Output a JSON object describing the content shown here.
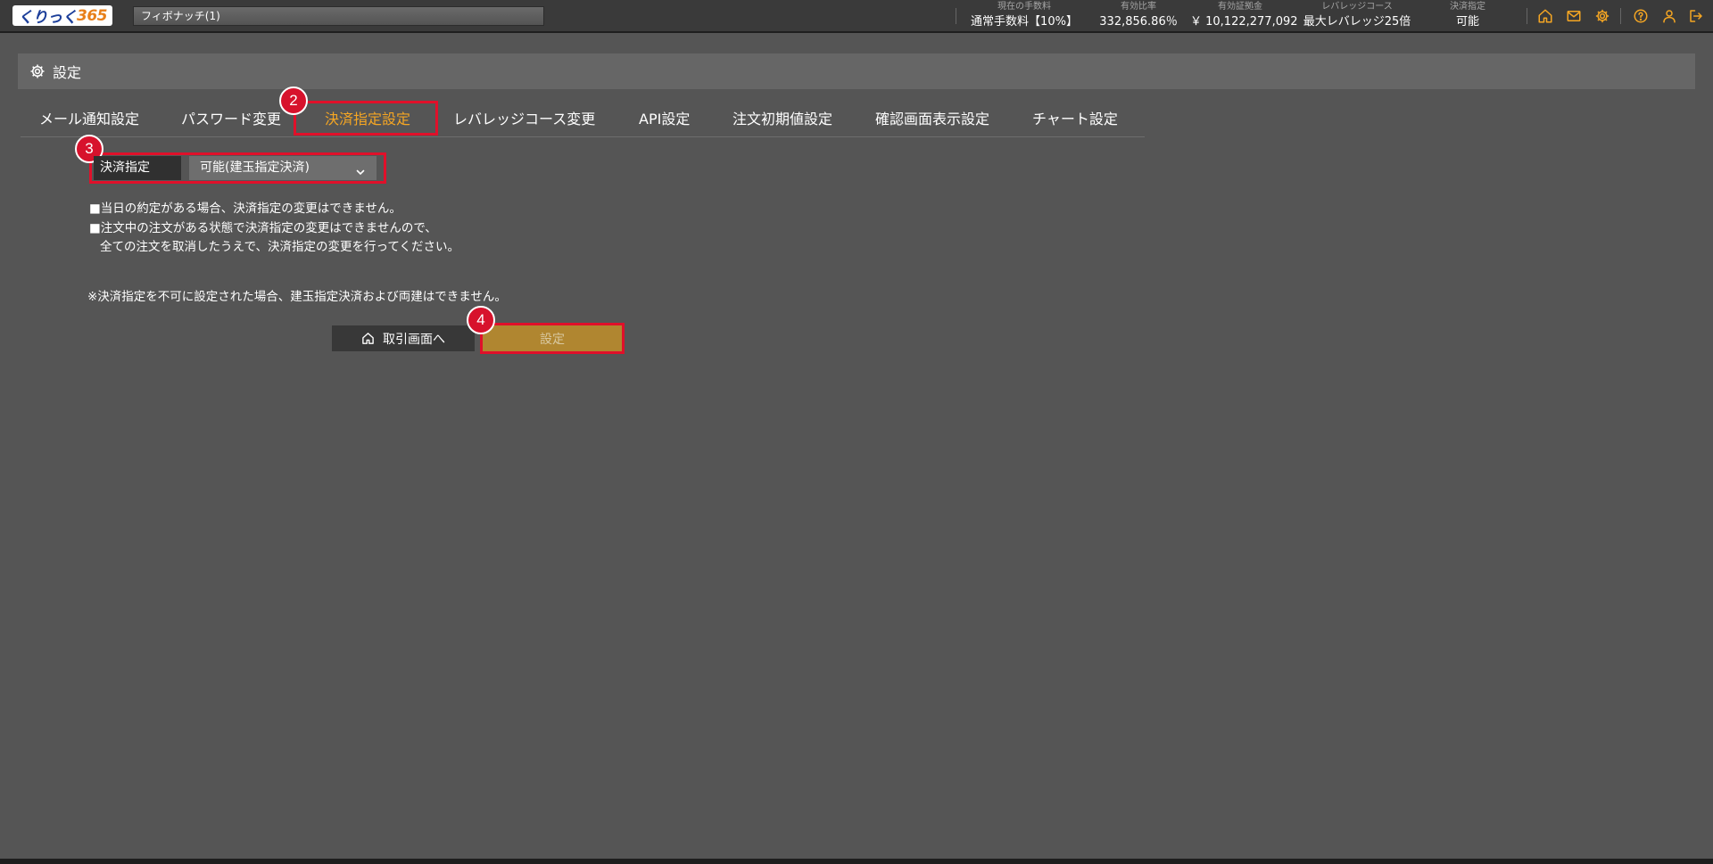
{
  "topbar": {
    "logo_text": "くりっく",
    "logo_num": "365",
    "account": "フィボナッチ(1)",
    "stats": [
      {
        "label": "現在の手数料",
        "value": "通常手数料【10%】"
      },
      {
        "label": "有効比率",
        "value": "332,856.86％"
      },
      {
        "label": "有効証拠金",
        "value": "￥ 10,122,277,092"
      },
      {
        "label": "レバレッジコース",
        "value": "最大レバレッジ25倍"
      },
      {
        "label": "決済指定",
        "value": "可能"
      }
    ],
    "icons": [
      "home-icon",
      "mail-icon",
      "settings-icon",
      "help-icon",
      "user-icon",
      "logout-icon"
    ],
    "accent_color": "#f5a623"
  },
  "header": {
    "title": "設定"
  },
  "tabs": [
    {
      "label": "メール通知設定"
    },
    {
      "label": "パスワード変更"
    },
    {
      "label": "決済指定設定",
      "active": true
    },
    {
      "label": "レバレッジコース変更"
    },
    {
      "label": "API設定"
    },
    {
      "label": "注文初期値設定"
    },
    {
      "label": "確認画面表示設定"
    },
    {
      "label": "チャート設定"
    }
  ],
  "badges": {
    "b2": "2",
    "b3": "3",
    "b4": "4"
  },
  "settlement": {
    "label": "決済指定",
    "value": "可能(建玉指定決済)"
  },
  "notes": {
    "line1": "■当日の約定がある場合、決済指定の変更はできません。",
    "line2": "■注文中の注文がある状態で決済指定の変更はできませんので、",
    "line3": "全ての注文を取消したうえで、決済指定の変更を行ってください。",
    "line4": "※決済指定を不可に設定された場合、建玉指定決済および両建はできません。"
  },
  "buttons": {
    "home": "取引画面へ",
    "set": "設定"
  }
}
